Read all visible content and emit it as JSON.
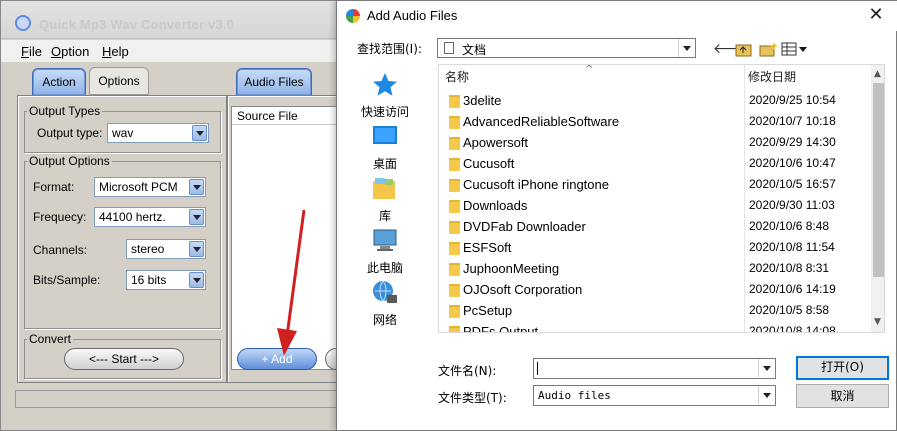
{
  "app": {
    "title": "Quick Mp3 Wav Converter v3.0",
    "menu": [
      {
        "label": "File",
        "accel": "F"
      },
      {
        "label": "Option",
        "accel": "O"
      },
      {
        "label": "Help",
        "accel": "H"
      }
    ],
    "tabs": {
      "action": "Action",
      "options": "Options",
      "audio_files": "Audio Files"
    },
    "output_types": {
      "group": "Output Types",
      "label": "Output type:",
      "value": "wav"
    },
    "output_options": {
      "group": "Output Options",
      "format_label": "Format:",
      "format_value": "Microsoft PCM",
      "freq_label": "Frequecy:",
      "freq_value": "44100 hertz.",
      "channels_label": "Channels:",
      "channels_value": "stereo",
      "bits_label": "Bits/Sample:",
      "bits_value": "16 bits"
    },
    "convert": {
      "group": "Convert",
      "start_label": "<--- Start --->"
    },
    "source": {
      "header": "Source File",
      "add_label": "+ Add"
    }
  },
  "dialog": {
    "title": "Add Audio Files",
    "close_glyph": "✕",
    "look_in_label": "查找范围(I):",
    "look_in_value": "文档",
    "toolbar_icons": [
      "back-arrow-icon",
      "up-folder-icon",
      "new-folder-icon",
      "view-menu-icon"
    ],
    "places": [
      {
        "label": "快速访问",
        "icon": "quick-access-star-icon"
      },
      {
        "label": "桌面",
        "icon": "desktop-icon"
      },
      {
        "label": "库",
        "icon": "library-icon"
      },
      {
        "label": "此电脑",
        "icon": "this-pc-icon"
      },
      {
        "label": "网络",
        "icon": "network-icon"
      }
    ],
    "columns": {
      "name": "名称",
      "date": "修改日期"
    },
    "files": [
      {
        "name": "3delite",
        "date": "2020/9/25 10:54"
      },
      {
        "name": "AdvancedReliableSoftware",
        "date": "2020/10/7 10:18"
      },
      {
        "name": "Apowersoft",
        "date": "2020/9/29 14:30"
      },
      {
        "name": "Cucusoft",
        "date": "2020/10/6 10:47"
      },
      {
        "name": "Cucusoft iPhone ringtone",
        "date": "2020/10/5 16:57"
      },
      {
        "name": "Downloads",
        "date": "2020/9/30 11:03"
      },
      {
        "name": "DVDFab Downloader",
        "date": "2020/10/6 8:48"
      },
      {
        "name": "ESFSoft",
        "date": "2020/10/8 11:54"
      },
      {
        "name": "JuphoonMeeting",
        "date": "2020/10/8 8:31"
      },
      {
        "name": "OJOsoft Corporation",
        "date": "2020/10/6 14:19"
      },
      {
        "name": "PcSetup",
        "date": "2020/10/5 8:58"
      },
      {
        "name": "PDFs Output",
        "date": "2020/10/8 14:08"
      }
    ],
    "filename_label": "文件名(N):",
    "filename_value": "",
    "filetype_label": "文件类型(T):",
    "filetype_value": "Audio files",
    "open_label": "打开(O)",
    "cancel_label": "取消"
  },
  "colors": {
    "accent": "#0078d7",
    "folder": "#f6c94b",
    "tab_active": "#8fb3e6"
  }
}
